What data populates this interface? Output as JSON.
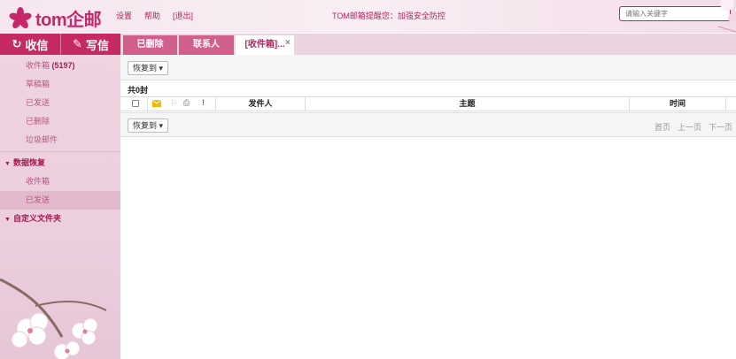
{
  "brand": {
    "logo_text": "tom企邮"
  },
  "header": {
    "links": [
      "设置",
      "帮助",
      "[退出]"
    ],
    "notice": "TOM邮箱提醒您：加强安全防控",
    "search_placeholder": "请输入关键字"
  },
  "nav_buttons": {
    "receive": "收信",
    "compose": "写信"
  },
  "sidebar": {
    "folders": [
      {
        "label": "收件箱",
        "count": "(5197)"
      },
      {
        "label": "草稿箱"
      },
      {
        "label": "已发送"
      },
      {
        "label": "已删除"
      },
      {
        "label": "垃圾邮件"
      }
    ],
    "group_recovery": {
      "label": "数据恢复",
      "items": [
        "收件箱",
        "已发送"
      ]
    },
    "group_custom": {
      "label": "自定义文件夹"
    }
  },
  "tabs": [
    {
      "label": "已删除"
    },
    {
      "label": "联系人"
    },
    {
      "label": "[收件箱]...",
      "active": true,
      "close": "×"
    }
  ],
  "list": {
    "restore_button": "恢复到 ▾",
    "count_text": "共0封",
    "columns": {
      "sender": "发件人",
      "subject": "主题",
      "time": "时间"
    },
    "header_icons": {
      "flag": "!"
    },
    "pager": [
      "首页",
      "上一页",
      "下一页"
    ]
  },
  "colors": {
    "brand": "#c6266a",
    "nav_button": "#c52a62",
    "tab_inactive": "#d15f8b",
    "sidebar_bg": "#efd3e1",
    "flag": "#e23a2a",
    "envelope": "#f0b800"
  }
}
